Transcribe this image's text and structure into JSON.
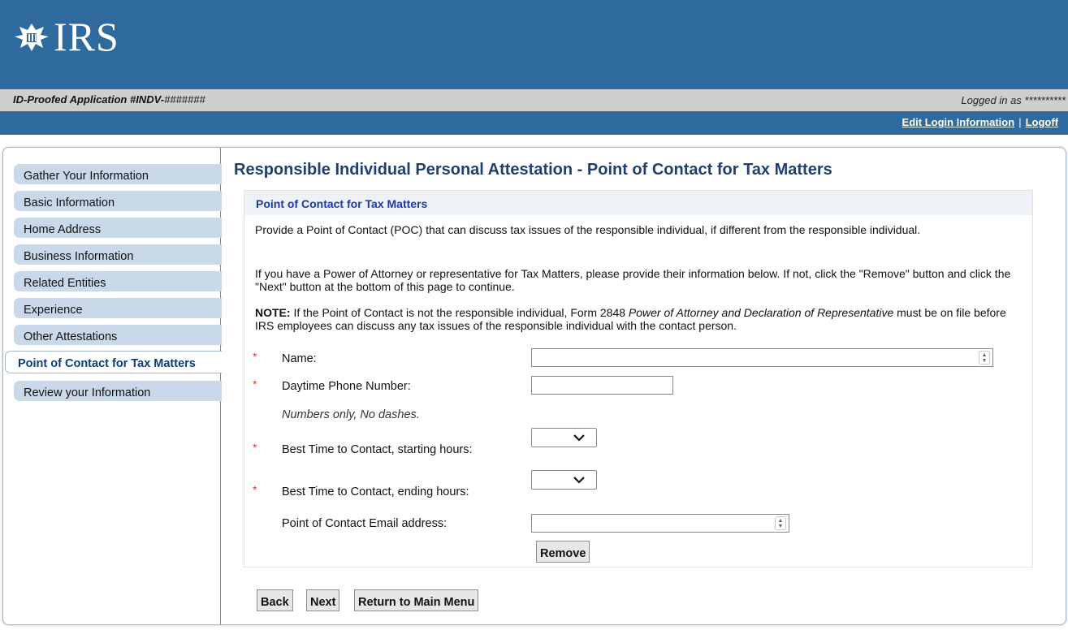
{
  "header": {
    "logo_text": "IRS"
  },
  "status_bar": {
    "app_prefix": "ID-Proofed Application #INDV-",
    "app_mask": "#######",
    "logged_in": "Logged in as **********"
  },
  "links": {
    "edit_login": "Edit Login Information",
    "separator": "|",
    "logoff": "Logoff"
  },
  "sidebar": {
    "items": [
      {
        "label": "Gather Your Information"
      },
      {
        "label": "Basic Information"
      },
      {
        "label": "Home Address"
      },
      {
        "label": "Business Information"
      },
      {
        "label": "Related Entities"
      },
      {
        "label": "Experience"
      },
      {
        "label": "Other Attestations"
      },
      {
        "label": "Point of Contact for Tax Matters",
        "active": true
      },
      {
        "label": "Review your Information"
      }
    ]
  },
  "main": {
    "title": "Responsible Individual Personal Attestation - Point of Contact for Tax Matters",
    "panel": {
      "header": "Point of Contact for Tax Matters",
      "para1": "Provide a Point of Contact (POC) that can discuss tax issues of the responsible individual, if different from the responsible individual.",
      "para2": "If you have a Power of Attorney or representative for Tax Matters, please provide their information below. If not, click the \"Remove\" button and click the \"Next\" button at the bottom of this page to continue.",
      "note_label": "NOTE:",
      "note_text_1": " If the Point of Contact is not the responsible individual, Form 2848 ",
      "note_italic": "Power of Attorney and Declaration of Representative",
      "note_text_2": " must be on file before IRS employees can discuss any tax issues of the responsible individual with the contact person."
    },
    "form": {
      "required_marker": "*",
      "name_label": "Name:",
      "name_value": "",
      "phone_label": "Daytime Phone Number:",
      "phone_value": "",
      "phone_hint": "Numbers only, No dashes.",
      "start_label": "Best Time to Contact, starting hours:",
      "start_value": "",
      "end_label": "Best Time to Contact, ending hours:",
      "end_value": "",
      "email_label": "Point of Contact Email address:",
      "email_value": "",
      "remove_button": "Remove"
    },
    "buttons": {
      "back": "Back",
      "next": "Next",
      "return": "Return to Main Menu"
    }
  },
  "colors": {
    "header_blue": "#2e6a9e",
    "nav_bg": "#c9d9ea",
    "title_navy": "#1f3f6e",
    "required_red": "#c8472e"
  }
}
